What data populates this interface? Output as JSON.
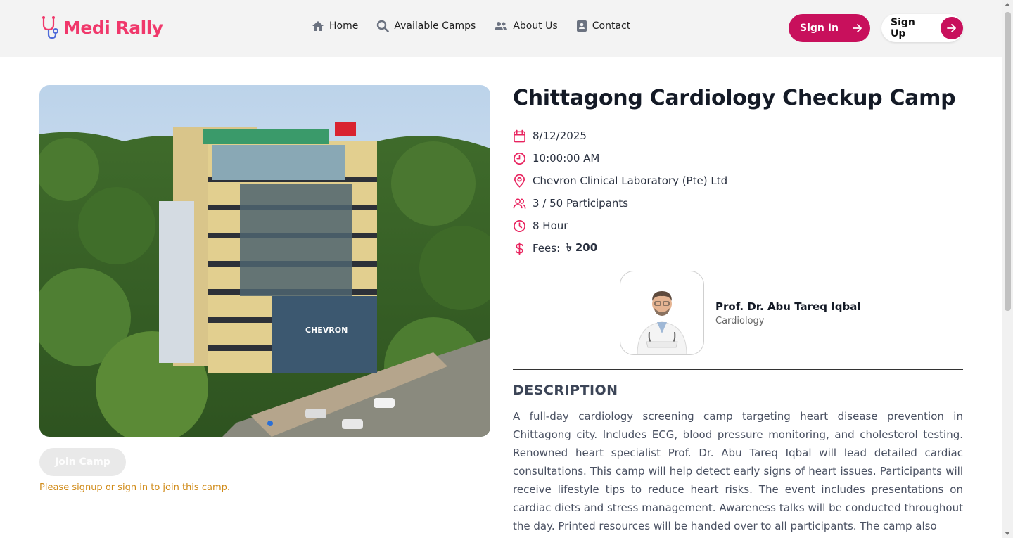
{
  "brand": {
    "name": "Medi Rally",
    "accent": "#f0386b",
    "primary": "#c8105c"
  },
  "nav": {
    "items": [
      {
        "label": "Home",
        "icon": "home-icon"
      },
      {
        "label": "Available Camps",
        "icon": "search-icon"
      },
      {
        "label": "About Us",
        "icon": "users-icon"
      },
      {
        "label": "Contact",
        "icon": "contact-icon"
      }
    ],
    "sign_in": "Sign In",
    "sign_up": "Sign Up"
  },
  "camp": {
    "title": "Chittagong Cardiology Checkup Camp",
    "date": "8/12/2025",
    "time": "10:00:00 AM",
    "location": "Chevron Clinical Laboratory (Pte) Ltd",
    "participants": "3 / 50 Participants",
    "duration": "8 Hour",
    "fees_label": "Fees:",
    "fees_value": "৳ 200",
    "building_sign": "CHEVRON"
  },
  "doctor": {
    "name": "Prof. Dr. Abu Tareq Iqbal",
    "specialty": "Cardiology"
  },
  "actions": {
    "join_label": "Join Camp",
    "login_note": "Please signup or sign in to join this camp."
  },
  "description": {
    "heading": "DESCRIPTION",
    "text": "A full-day cardiology screening camp targeting heart disease prevention in Chittagong city. Includes ECG, blood pressure monitoring, and cholesterol testing. Renowned heart specialist Prof. Dr. Abu Tareq Iqbal will lead detailed cardiac consultations. This camp will help detect early signs of heart issues. Participants will receive lifestyle tips to reduce heart risks. The event includes presentations on cardiac diets and stress management. Awareness talks will be conducted throughout the day. Printed resources will be handed over to all participants. The camp also"
  }
}
